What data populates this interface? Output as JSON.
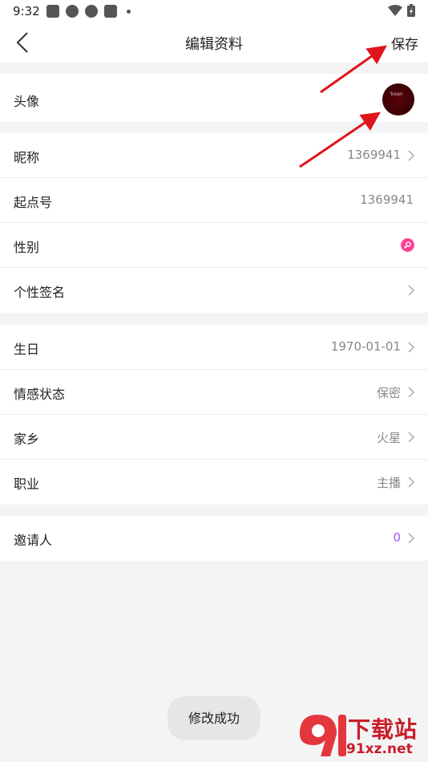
{
  "status_bar": {
    "time": "9:32"
  },
  "header": {
    "title": "编辑资料",
    "save_label": "保存"
  },
  "avatar_section": {
    "label": "头像",
    "avatar_text": "'bean"
  },
  "profile_section": {
    "rows": [
      {
        "label": "昵称",
        "value": "1369941"
      },
      {
        "label": "起点号",
        "value": "1369941"
      },
      {
        "label": "性别",
        "value": ""
      },
      {
        "label": "个性签名",
        "value": ""
      }
    ]
  },
  "detail_section": {
    "rows": [
      {
        "label": "生日",
        "value": "1970-01-01"
      },
      {
        "label": "情感状态",
        "value": "保密"
      },
      {
        "label": "家乡",
        "value": "火星"
      },
      {
        "label": "职业",
        "value": "主播"
      }
    ]
  },
  "invite_section": {
    "label": "邀请人",
    "value": "0"
  },
  "toast": {
    "text": "修改成功"
  },
  "watermark": {
    "top": "下载站",
    "bottom": "91xz.net"
  },
  "colors": {
    "gender_dot": "#ff3f94",
    "invite_value": "#9b5cf0",
    "arrow": "#e0141c"
  }
}
